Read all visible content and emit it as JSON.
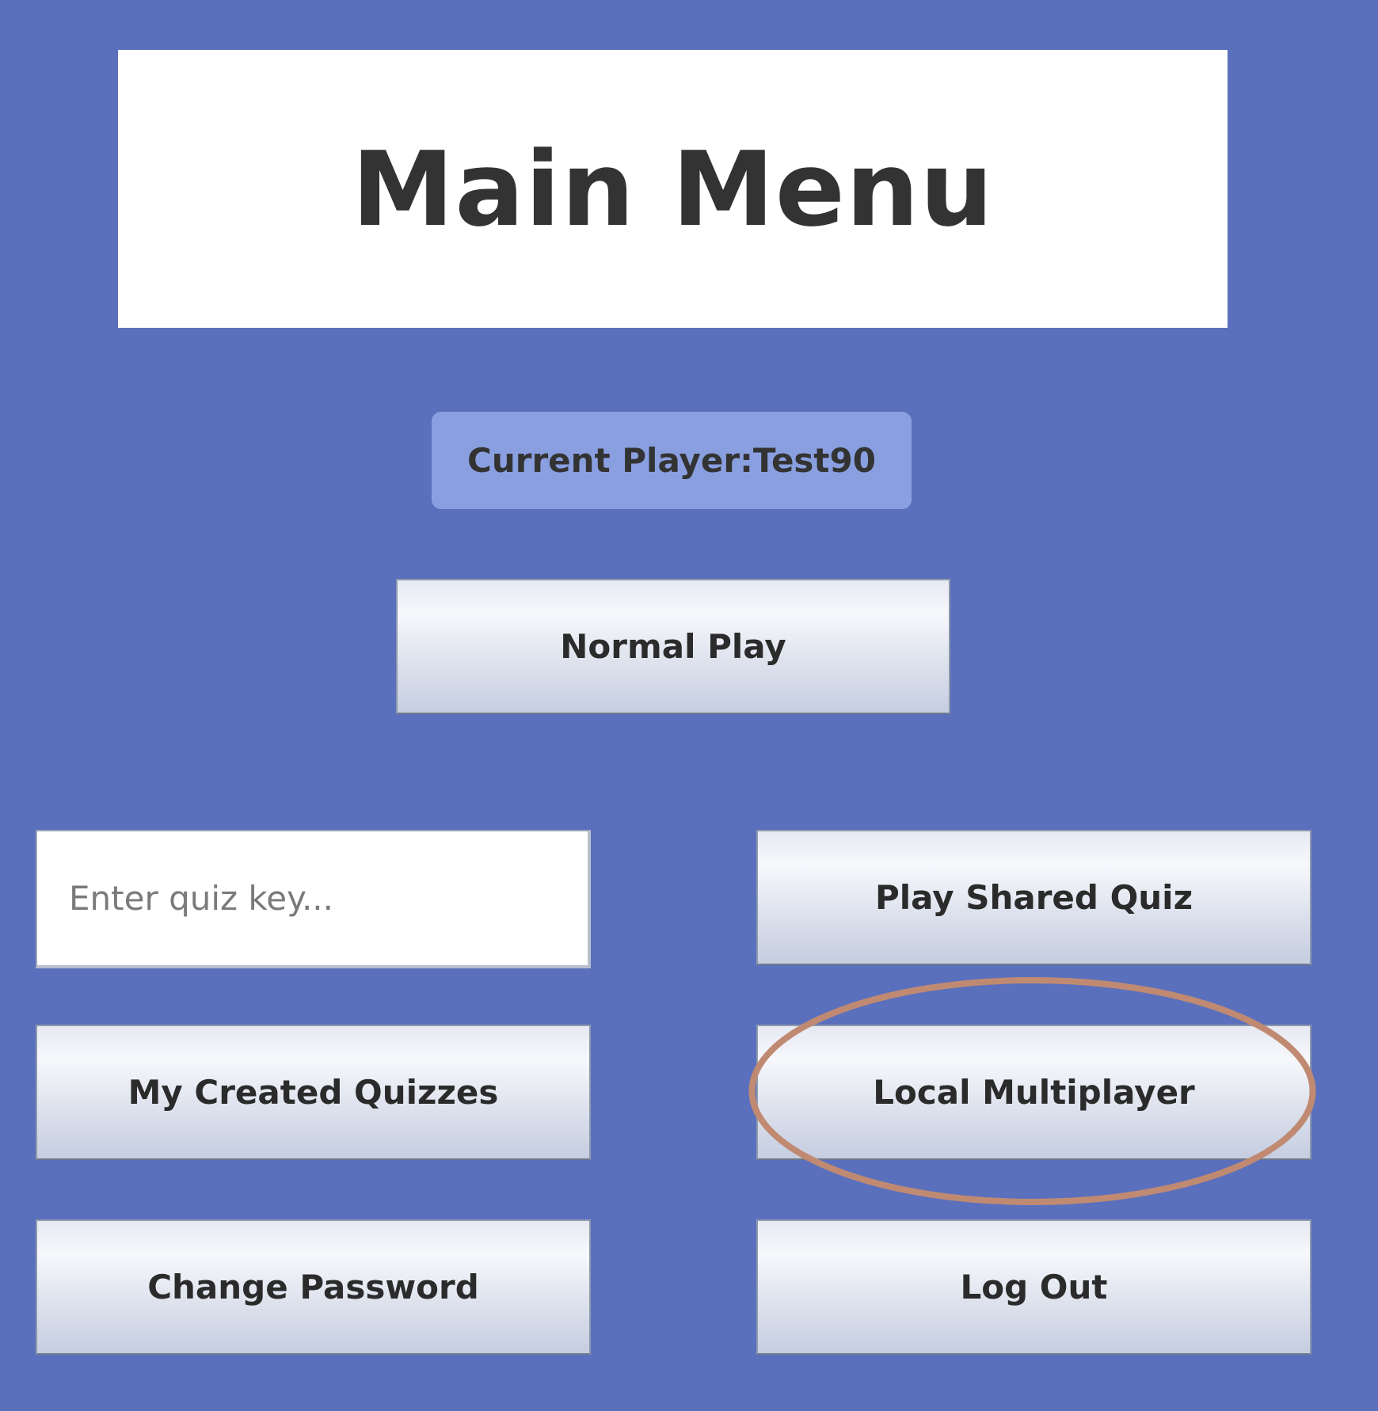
{
  "window": {
    "title": "Main Menu"
  },
  "player": {
    "label": "Current Player:",
    "name": "Test90"
  },
  "buttons": {
    "normal_play": "Normal Play",
    "play_shared_quiz": "Play Shared Quiz",
    "my_created_quizzes": "My Created Quizzes",
    "local_multiplayer": "Local Multiplayer",
    "change_password": "Change Password",
    "log_out": "Log Out"
  },
  "quiz_key": {
    "value": "",
    "placeholder": "Enter quiz key..."
  },
  "colors": {
    "background": "#5B70BC",
    "title_box": "#FFFFFF",
    "player_badge": "#899FE0",
    "highlight_ring": "#C08A72"
  }
}
